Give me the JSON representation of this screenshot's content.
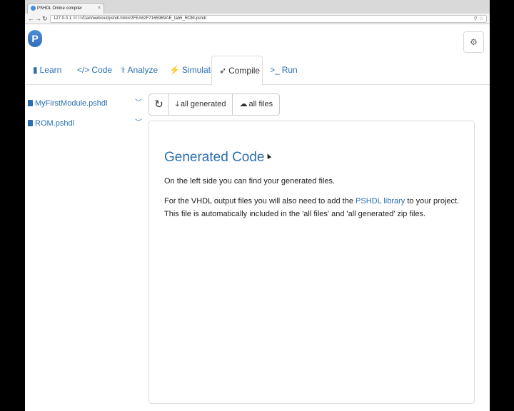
{
  "browser": {
    "tab_title": "PSHDL Online compiler",
    "url_host": "127.0.0.1",
    "url_port": ":3030",
    "url_path": "/Dart/web/out/pshdl.html#2FEA62F71659B9AE_tab5_ROM.pshdl",
    "back_icon": "arrow-left",
    "forward_icon": "arrow-right",
    "reload_icon": "reload"
  },
  "app": {
    "logo_letter": "P",
    "settings_icon": "gear"
  },
  "nav": {
    "tabs": [
      {
        "label": "Learn",
        "icon": "book",
        "glyph": "▮"
      },
      {
        "label": "Code",
        "icon": "code",
        "glyph": "</>"
      },
      {
        "label": "Analyze",
        "icon": "stethoscope",
        "glyph": "⚕"
      },
      {
        "label": "Simulate",
        "icon": "bolt",
        "glyph": "⚡"
      },
      {
        "label": "Compile",
        "icon": "rocket",
        "glyph": "➶"
      },
      {
        "label": "Run",
        "icon": "terminal",
        "glyph": ">_"
      }
    ],
    "active_tab": "Compile"
  },
  "sidebar": {
    "files": [
      {
        "name": "MyFirstModule.pshdl"
      },
      {
        "name": "ROM.pshdl"
      }
    ]
  },
  "toolbar": {
    "refresh_icon": "refresh",
    "refresh_glyph": "↻",
    "all_generated_label": "all generated",
    "all_generated_glyph": "⤓",
    "all_files_label": "all files",
    "all_files_glyph": "☁"
  },
  "panel": {
    "title": "Generated Code",
    "paragraph1": "On the left side you can find your generated files.",
    "paragraph2_before": "For the VHDL output files you will also need to add the ",
    "paragraph2_link": "PSHDL library",
    "paragraph2_after": " to your project. This file is automatically included in the 'all files' and 'all generated' zip files."
  }
}
